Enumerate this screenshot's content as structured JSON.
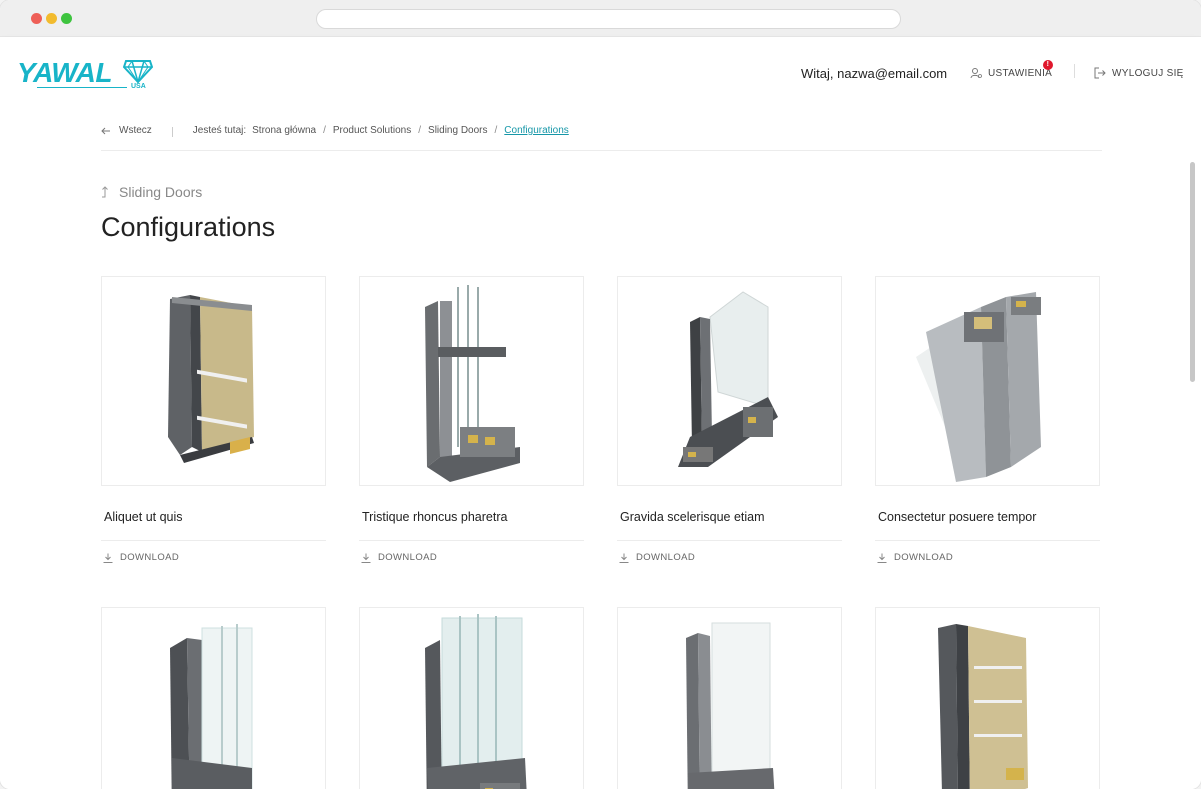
{
  "brand": {
    "name": "YAWAL",
    "sub": "USA",
    "accent": "#18b4c8"
  },
  "header": {
    "greeting": "Witaj, nazwa@email.com",
    "settings_label": "USTAWIENIA",
    "settings_badge": "!",
    "logout_label": "WYLOGUJ SIĘ"
  },
  "breadcrumb": {
    "back_label": "Wstecz",
    "here_label": "Jesteś tutaj:",
    "items": [
      "Strona główna",
      "Product Solutions",
      "Sliding Doors"
    ],
    "current": "Configurations"
  },
  "page": {
    "parent": "Sliding Doors",
    "title": "Configurations"
  },
  "download_label": "DOWNLOAD",
  "products": [
    {
      "name": "Aliquet ut quis",
      "image": "panel-door-profile"
    },
    {
      "name": "Tristique rhoncus pharetra",
      "image": "triple-glazing-profile"
    },
    {
      "name": "Gravida scelerisque etiam",
      "image": "corner-window-profile"
    },
    {
      "name": "Consectetur posuere tempor",
      "image": "tall-frame-profile"
    },
    {
      "name": "",
      "image": "window-frame-profile"
    },
    {
      "name": "",
      "image": "multi-glass-profile"
    },
    {
      "name": "",
      "image": "single-glass-profile"
    },
    {
      "name": "",
      "image": "panel-door-profile"
    }
  ]
}
